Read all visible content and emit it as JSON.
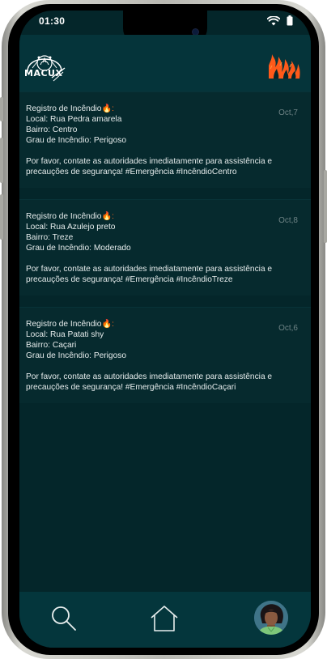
{
  "status_bar": {
    "time": "01:30",
    "icons": [
      "wifi-icon",
      "battery-icon"
    ]
  },
  "header": {
    "logo_text": "MACUX",
    "logo_icon": "macux-logo",
    "right_icon": "fire-logo"
  },
  "posts": [
    {
      "title": "Registro de Incêndio",
      "emoji": "🔥:",
      "local": "Local: Rua Pedra amarela",
      "bairro": "Bairro: Centro",
      "grau": "Grau de Incêndio: Perigoso",
      "message_line1": "Por favor, contate as autoridades imediatamente para assistência e",
      "message_line2": "precauções de segurança! #Emergência #IncêndioCentro",
      "date": "Oct,7"
    },
    {
      "title": "Registro de Incêndio",
      "emoji": "🔥:",
      "local": "Local: Rua Azulejo preto",
      "bairro": "Bairro: Treze",
      "grau": "Grau de Incêndio: Moderado",
      "message_line1": "Por favor, contate as autoridades imediatamente para assistência e",
      "message_line2": "precauções de segurança! #Emergência #IncêndioTreze",
      "date": "Oct,8"
    },
    {
      "title": "Registro de Incêndio",
      "emoji": "🔥:",
      "local": "Local: Rua Patati shy",
      "bairro": "Bairro: Caçari",
      "grau": "Grau de Incêndio: Perigoso",
      "message_line1": "Por favor, contate as autoridades imediatamente para assistência e",
      "message_line2": "precauções de segurança! #Emergência #IncêndioCaçari",
      "date": "Oct,6"
    }
  ],
  "bottom_nav": {
    "items": [
      "search-icon",
      "home-icon",
      "profile-avatar"
    ]
  },
  "colors": {
    "background": "#04262a",
    "header": "#05343a",
    "card": "#062a2e",
    "text": "#e6ecec",
    "date": "#6f8486",
    "fire_accent": "#ff5a1a"
  }
}
